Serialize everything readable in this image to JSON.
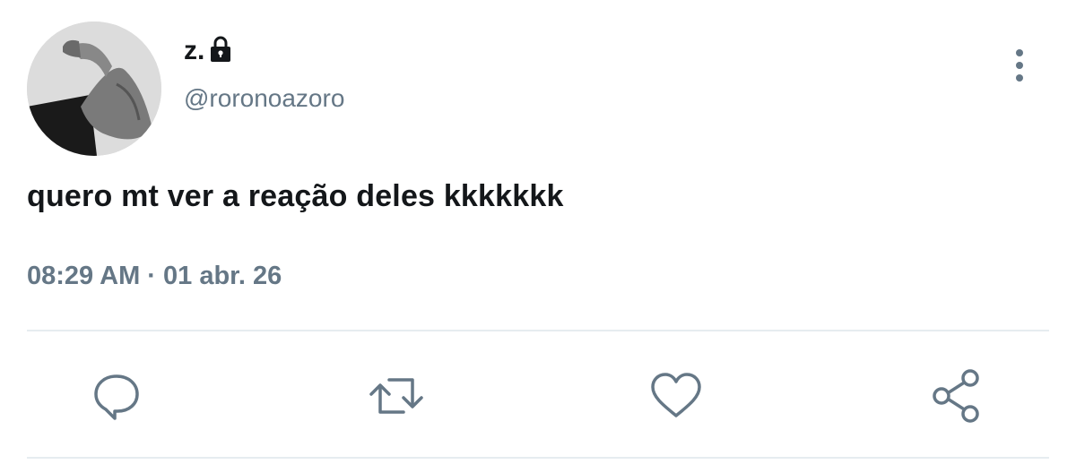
{
  "tweet": {
    "display_name": "z.",
    "handle": "@roronoazoro",
    "text": "quero mt ver a reação deles kkkkkkk",
    "timestamp": "08:29 AM · 01 abr. 26"
  },
  "icons": {
    "avatar": "flexed-arm-photo",
    "lock": "lock-icon",
    "more": "vertical-dots-icon",
    "reply": "reply-icon",
    "retweet": "retweet-icon",
    "like": "heart-icon",
    "share": "share-icon"
  },
  "colors": {
    "text_primary": "#14171a",
    "text_secondary": "#657786",
    "icon": "#657786",
    "divider": "#e6ecf0"
  }
}
